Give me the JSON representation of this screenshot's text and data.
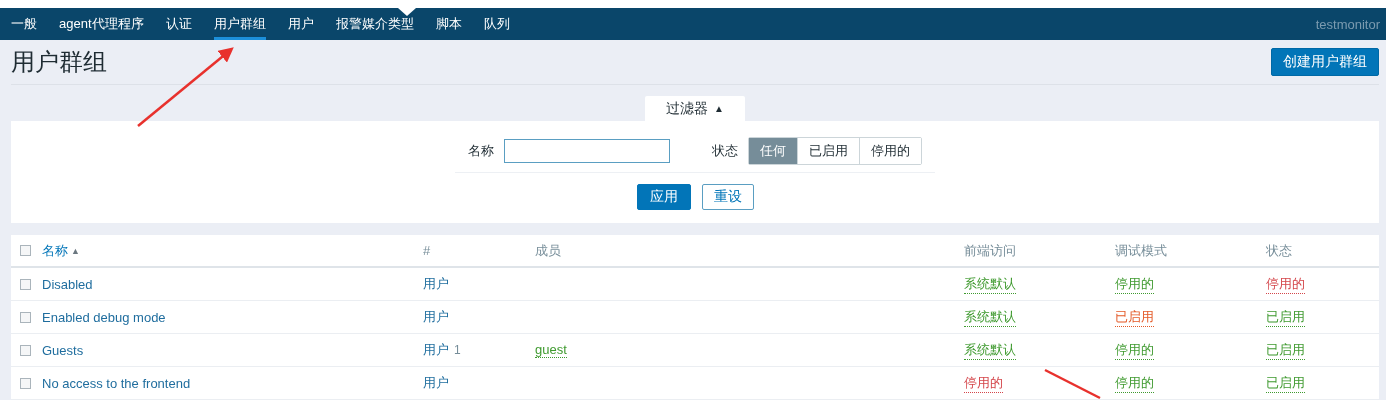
{
  "nav": {
    "items": [
      {
        "label": "一般",
        "selected": false
      },
      {
        "label": "agent代理程序",
        "selected": false
      },
      {
        "label": "认证",
        "selected": false
      },
      {
        "label": "用户群组",
        "selected": true
      },
      {
        "label": "用户",
        "selected": false
      },
      {
        "label": "报警媒介类型",
        "selected": false
      },
      {
        "label": "脚本",
        "selected": false
      },
      {
        "label": "队列",
        "selected": false
      }
    ],
    "user": "testmonitor"
  },
  "page": {
    "title": "用户群组",
    "create_button": "创建用户群组"
  },
  "filter": {
    "tab_label": "过滤器",
    "tab_toggle": "▲",
    "name_label": "名称",
    "status_label": "状态",
    "status_options": [
      {
        "label": "任何",
        "selected": true
      },
      {
        "label": "已启用",
        "selected": false
      },
      {
        "label": "停用的",
        "selected": false
      }
    ],
    "apply_button": "应用",
    "reset_button": "重设"
  },
  "table": {
    "select_all_checked": false,
    "columns": [
      {
        "label": "名称",
        "sort": "▲"
      },
      {
        "label": "#"
      },
      {
        "label": "成员"
      },
      {
        "label": "前端访问"
      },
      {
        "label": "调试模式"
      },
      {
        "label": "状态"
      }
    ],
    "rows": [
      {
        "checked": false,
        "name": "Disabled",
        "users_link": "用户",
        "frontend": {
          "text": "系统默认",
          "color": "#3f9a2f"
        },
        "debug": {
          "text": "停用的",
          "color": "#3f9a2f"
        },
        "status": {
          "text": "停用的",
          "color": "#d4454a"
        }
      },
      {
        "checked": false,
        "name": "Enabled debug mode",
        "users_link": "用户",
        "frontend": {
          "text": "系统默认",
          "color": "#3f9a2f"
        },
        "debug": {
          "text": "已启用",
          "color": "#e45a28"
        },
        "status": {
          "text": "已启用",
          "color": "#3f9a2f"
        }
      },
      {
        "checked": false,
        "name": "Guests",
        "users_link": "用户",
        "user_count": "1",
        "members": "guest",
        "frontend": {
          "text": "系统默认",
          "color": "#3f9a2f"
        },
        "debug": {
          "text": "停用的",
          "color": "#3f9a2f"
        },
        "status": {
          "text": "已启用",
          "color": "#3f9a2f"
        }
      },
      {
        "checked": false,
        "name": "No access to the frontend",
        "users_link": "用户",
        "frontend": {
          "text": "停用的",
          "color": "#d4454a"
        },
        "debug": {
          "text": "停用的",
          "color": "#3f9a2f"
        },
        "status": {
          "text": "已启用",
          "color": "#3f9a2f"
        }
      }
    ]
  }
}
